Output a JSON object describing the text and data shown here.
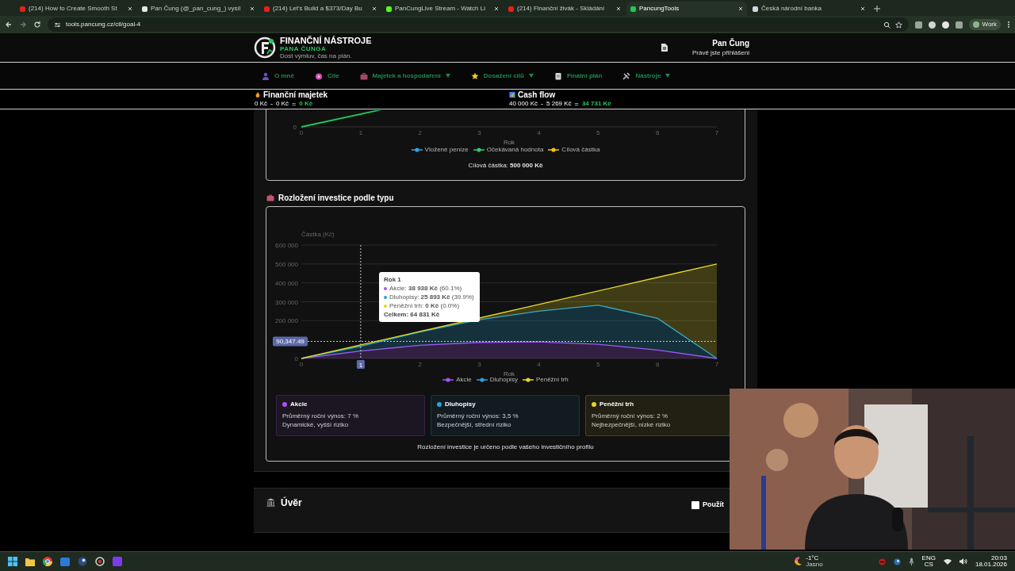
{
  "browser": {
    "tabs": [
      {
        "title": "(214) How to Create Smooth St",
        "selected": false,
        "color": "#e62117"
      },
      {
        "title": "Pan Čung (@_pan_cung_) vysíl",
        "selected": false,
        "color": "#e5e5e5"
      },
      {
        "title": "(214) Let's Build a $373/Day Bu",
        "selected": false,
        "color": "#e62117"
      },
      {
        "title": "PanCungLive Stream - Watch Li",
        "selected": false,
        "color": "#53fc18"
      },
      {
        "title": "(214) Finanční živák - Skládání",
        "selected": false,
        "color": "#e62117"
      },
      {
        "title": "PancungTools",
        "selected": true,
        "color": "#22c55e"
      },
      {
        "title": "Česká národní banka",
        "selected": false,
        "color": "#cfd8dc"
      }
    ],
    "url": "tools.pancung.cz/cil/goal-4",
    "profile": "Work"
  },
  "header": {
    "title": "FINANČNÍ NÁSTROJE",
    "subtitle": "PANA ČUNGA",
    "tagline": "Dost výmluv, čas na plán.",
    "user_name": "Pan Čung",
    "user_status": "Právě jste přihlášeni"
  },
  "nav": [
    {
      "label": "O mně",
      "has_menu": false
    },
    {
      "label": "Cíle",
      "has_menu": false
    },
    {
      "label": "Majetek a hospodaření",
      "has_menu": true
    },
    {
      "label": "Dosažení cílů",
      "has_menu": true
    },
    {
      "label": "Finální plán",
      "has_menu": false
    },
    {
      "label": "Nástroje",
      "has_menu": true
    }
  ],
  "summary": [
    {
      "title": "Finanční majetek",
      "a": "0 Kč",
      "minus": "-",
      "b": "0 Kč",
      "equals": "=",
      "result": "0 Kč"
    },
    {
      "title": "Cash flow",
      "a": "40 000 Kč",
      "minus": "-",
      "b": "5 269 Kč",
      "equals": "=",
      "result": "34 731 Kč"
    }
  ],
  "goal_chart": {
    "y_tick": "0",
    "x_ticks": [
      "0",
      "1",
      "2",
      "3",
      "4",
      "5",
      "6",
      "7"
    ],
    "xlabel": "Rok",
    "legend": [
      {
        "label": "Vložené peníze",
        "color": "#36a2eb"
      },
      {
        "label": "Očekávaná hodnota",
        "color": "#2ecc71"
      },
      {
        "label": "Cílová částka",
        "color": "#f1c40f"
      }
    ],
    "target": "Cílová částka: **500 000 Kč**"
  },
  "allocation": {
    "title": "Rozložení investice podle typu",
    "chart_data": {
      "type": "area",
      "stacked": true,
      "grid": true,
      "xlabel": "Rok",
      "ylabel": "Částka (Kč)",
      "x": [
        0,
        1,
        2,
        3,
        4,
        5,
        6,
        7
      ],
      "xlim": [
        0,
        7
      ],
      "xticks": [
        0,
        1,
        2,
        3,
        4,
        5,
        6,
        7
      ],
      "ylim": [
        0,
        600000
      ],
      "yticks": [
        {
          "value": 0,
          "label": "0"
        },
        {
          "value": 200000,
          "label": "200 000"
        },
        {
          "value": 300000,
          "label": "300 000"
        },
        {
          "value": 400000,
          "label": "400 000"
        },
        {
          "value": 500000,
          "label": "500 000"
        },
        {
          "value": 600000,
          "label": "600 000"
        }
      ],
      "series": [
        {
          "name": "Akcie",
          "color": "#a855f7",
          "values": [
            0,
            39000,
            70000,
            85000,
            88000,
            75000,
            45000,
            0
          ]
        },
        {
          "name": "Dluhopisy",
          "color": "#22a5d8",
          "values": [
            0,
            26000,
            70000,
            120000,
            162000,
            207000,
            167000,
            0
          ]
        },
        {
          "name": "Peněžní trh",
          "color": "#e6d629",
          "values": [
            0,
            7000,
            3000,
            9000,
            36000,
            75000,
            217000,
            500000
          ]
        }
      ],
      "ref_lines": [
        {
          "axis": "x",
          "value": 1,
          "label": "1"
        },
        {
          "axis": "y",
          "value": 90347.49,
          "label": "90,347.49"
        }
      ]
    },
    "tooltip": {
      "title": "Rok 1",
      "items": [
        {
          "text": "Akcie: **38 938 Kč** (60.1%)",
          "color": "#a855f7"
        },
        {
          "text": "Dluhopisy: **25 893 Kč** (39.9%)",
          "color": "#22a5d8"
        },
        {
          "text": "Peněžní trh: **0 Kč** (0.0%)",
          "color": "#e6d629"
        }
      ],
      "total": "Celkem: 64 831 Kč"
    },
    "cards": [
      {
        "title": "Akcie",
        "color": "#a855f7",
        "line1": "Průměrný roční výnos: 7 %",
        "line2": "Dynamické, vyšší riziko"
      },
      {
        "title": "Dluhopisy",
        "color": "#22a5d8",
        "line1": "Průměrný roční výnos: 3,5 %",
        "line2": "Bezpečnější, střední riziko"
      },
      {
        "title": "Peněžní trh",
        "color": "#e6d629",
        "line1": "Průměrný roční výnos: 2 %",
        "line2": "Nejbezpečnější, nízké riziko"
      }
    ],
    "note": "Rozložení investice je určeno podle vašeho investičního profilu"
  },
  "loan": {
    "title": "Úvěr",
    "checkbox": {
      "label": "Použít",
      "checked": false
    }
  },
  "taskbar": {
    "weather_temp": "-1°C",
    "weather_text": "Jasno",
    "lang1": "ENG",
    "lang2": "CS",
    "time": "20:03",
    "date": "18.01.2026"
  }
}
